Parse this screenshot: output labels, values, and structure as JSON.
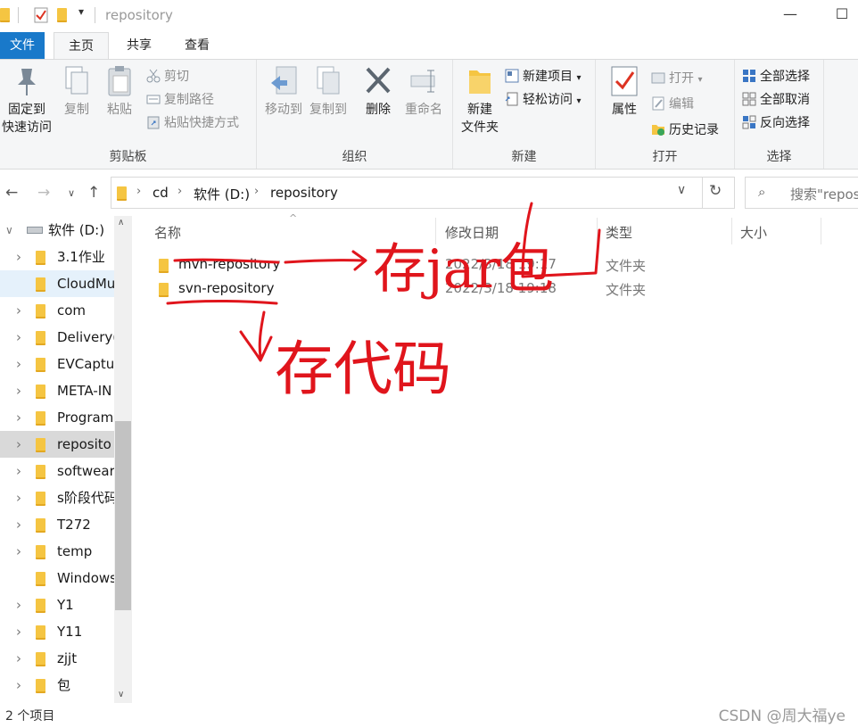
{
  "window": {
    "title": "repository",
    "minimize_glyph": "—",
    "maximize_glyph": "☐"
  },
  "ribbon_tabs": [
    "文件",
    "主页",
    "共享",
    "查看"
  ],
  "ribbon": {
    "clipboard": {
      "label": "剪贴板",
      "pin": "固定到",
      "pin2": "快速访问",
      "copy": "复制",
      "paste": "粘贴",
      "cut": "剪切",
      "copy_path": "复制路径",
      "paste_shortcut": "粘贴快捷方式"
    },
    "organize": {
      "label": "组织",
      "move_to": "移动到",
      "copy_to": "复制到",
      "delete": "删除",
      "rename": "重命名"
    },
    "new": {
      "label": "新建",
      "new_folder_1": "新建",
      "new_folder_2": "文件夹",
      "new_item": "新建项目",
      "easy_access": "轻松访问"
    },
    "open": {
      "label": "打开",
      "properties": "属性",
      "open": "打开",
      "edit": "编辑",
      "history": "历史记录"
    },
    "select": {
      "label": "选择",
      "select_all": "全部选择",
      "select_none": "全部取消",
      "invert": "反向选择"
    }
  },
  "address": {
    "crumbs": [
      "cd",
      "软件 (D:)",
      "repository"
    ]
  },
  "search": {
    "placeholder": "搜索\"repos"
  },
  "sidebar": {
    "drive": "软件 (D:)",
    "items": [
      "3.1作业",
      "CloudMu",
      "com",
      "Delivery(",
      "EVCaptu",
      "META-IN",
      "Program",
      "reposito",
      "softwear",
      "s阶段代码",
      "T272",
      "temp",
      "Windows",
      "Y1",
      "Y11",
      "zjjt",
      "包"
    ]
  },
  "columns": {
    "name": "名称",
    "modified": "修改日期",
    "type": "类型",
    "size": "大小"
  },
  "files": [
    {
      "name": "mvn-repository",
      "modified": "2022/3/18 19:17",
      "type": "文件夹"
    },
    {
      "name": "svn-repository",
      "modified": "2022/3/18 19:18",
      "type": "文件夹"
    }
  ],
  "status": {
    "count": "2 个项目",
    "watermark": "CSDN @周大福ye"
  },
  "annotations": {
    "color": "#e0151c",
    "note_1": "存jar包",
    "note_2": "存代码"
  }
}
